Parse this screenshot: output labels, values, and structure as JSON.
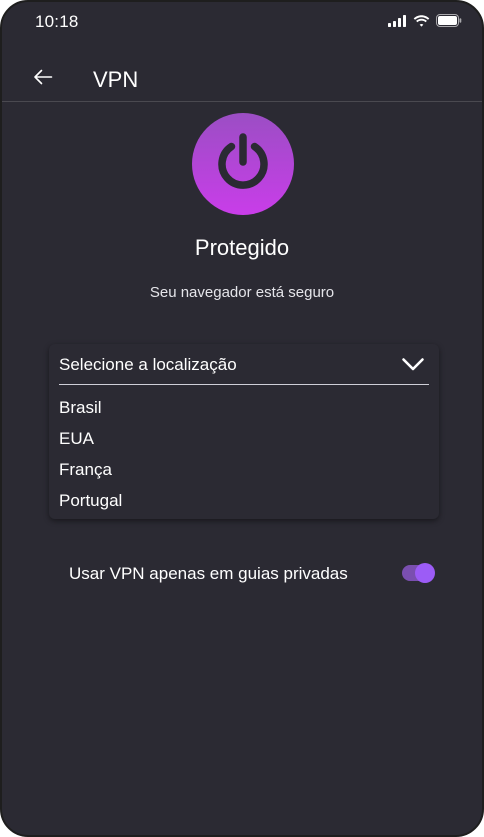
{
  "status_bar": {
    "time": "10:18",
    "icons": [
      "cellular-signal-icon",
      "wifi-icon",
      "battery-icon"
    ]
  },
  "header": {
    "back_icon": "arrow-left-icon",
    "title": "VPN"
  },
  "vpn": {
    "power_icon": "power-icon",
    "status": "Protegido",
    "subtitle": "Seu navegador está seguro",
    "accent_gradient": [
      "#9b4ec4",
      "#c93de9"
    ]
  },
  "location": {
    "label": "Selecione a localização",
    "chevron_icon": "chevron-down-icon",
    "options": [
      "Brasil",
      "EUA",
      "França",
      "Portugal"
    ]
  },
  "private_tabs": {
    "label": "Usar VPN apenas em guias privadas",
    "enabled": true,
    "toggle_color": "#9c5cf6"
  },
  "colors": {
    "background": "#2b2a33",
    "text": "#ffffff"
  }
}
